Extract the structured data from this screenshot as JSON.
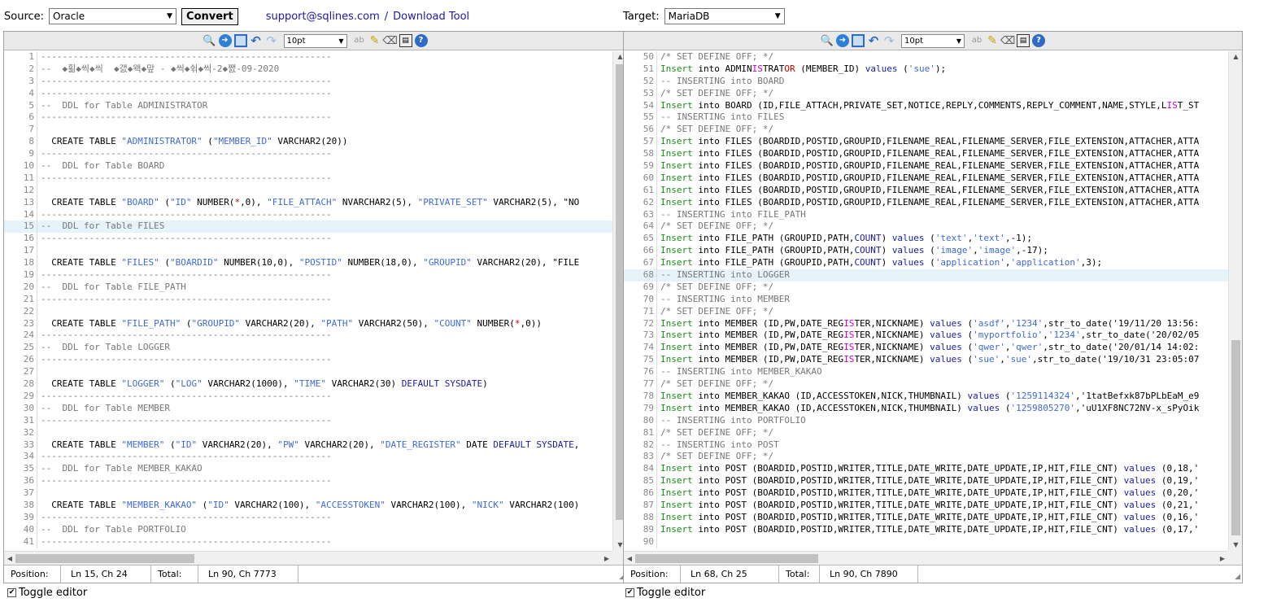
{
  "top": {
    "source_label": "Source:",
    "source_value": "Oracle",
    "convert_label": "Convert",
    "support_link": "support@sqlines.com",
    "separator": "/",
    "download_link": "Download Tool",
    "target_label": "Target:",
    "target_value": "MariaDB"
  },
  "toolbar": {
    "font_size": "10pt"
  },
  "left": {
    "status": {
      "pos_label": "Position:",
      "pos_value": "Ln 15, Ch 24",
      "total_label": "Total:",
      "total_value": "Ln 90, Ch 7773"
    },
    "lines": [
      {
        "n": "1",
        "t": "------------------------------------------------------",
        "c": "cm"
      },
      {
        "n": "2",
        "t": "--  ◆횖◆씩◆씩  ◆갨◆왝◆맢 - ◆씩◆쉮◆씩-2◆쨄-09-2020",
        "c": "cm"
      },
      {
        "n": "3",
        "t": "------------------------------------------------------",
        "c": "cm"
      },
      {
        "n": "4",
        "t": "------------------------------------------------------",
        "c": "cm"
      },
      {
        "n": "5",
        "t": "--  DDL for Table ADMINISTRATOR",
        "c": "cm"
      },
      {
        "n": "6",
        "t": "------------------------------------------------------",
        "c": "cm"
      },
      {
        "n": "7",
        "t": "",
        "c": "cm"
      },
      {
        "n": "8",
        "t": "  CREATE TABLE \"ADMINISTRATOR\" (\"MEMBER_ID\" VARCHAR2(20))",
        "c": "sql"
      },
      {
        "n": "9",
        "t": "------------------------------------------------------",
        "c": "cm"
      },
      {
        "n": "10",
        "t": "--  DDL for Table BOARD",
        "c": "cm"
      },
      {
        "n": "11",
        "t": "------------------------------------------------------",
        "c": "cm"
      },
      {
        "n": "12",
        "t": "",
        "c": "cm"
      },
      {
        "n": "13",
        "t": "  CREATE TABLE \"BOARD\" (\"ID\" NUMBER(*,0), \"FILE_ATTACH\" NVARCHAR2(5), \"PRIVATE_SET\" VARCHAR2(5), \"NO",
        "c": "sql"
      },
      {
        "n": "14",
        "t": "------------------------------------------------------",
        "c": "cm"
      },
      {
        "n": "15",
        "t": "--  DDL for Table FILES",
        "c": "cm",
        "active": true
      },
      {
        "n": "16",
        "t": "------------------------------------------------------",
        "c": "cm"
      },
      {
        "n": "17",
        "t": "",
        "c": "cm"
      },
      {
        "n": "18",
        "t": "  CREATE TABLE \"FILES\" (\"BOARDID\" NUMBER(10,0), \"POSTID\" NUMBER(18,0), \"GROUPID\" VARCHAR2(20), \"FILE",
        "c": "sql"
      },
      {
        "n": "19",
        "t": "------------------------------------------------------",
        "c": "cm"
      },
      {
        "n": "20",
        "t": "--  DDL for Table FILE_PATH",
        "c": "cm"
      },
      {
        "n": "21",
        "t": "------------------------------------------------------",
        "c": "cm"
      },
      {
        "n": "22",
        "t": "",
        "c": "cm"
      },
      {
        "n": "23",
        "t": "  CREATE TABLE \"FILE_PATH\" (\"GROUPID\" VARCHAR2(20), \"PATH\" VARCHAR2(50), \"COUNT\" NUMBER(*,0))",
        "c": "sql"
      },
      {
        "n": "24",
        "t": "------------------------------------------------------",
        "c": "cm"
      },
      {
        "n": "25",
        "t": "--  DDL for Table LOGGER",
        "c": "cm"
      },
      {
        "n": "26",
        "t": "------------------------------------------------------",
        "c": "cm"
      },
      {
        "n": "27",
        "t": "",
        "c": "cm"
      },
      {
        "n": "28",
        "t": "  CREATE TABLE \"LOGGER\" (\"LOG\" VARCHAR2(1000), \"TIME\" VARCHAR2(30) DEFAULT SYSDATE)",
        "c": "sql"
      },
      {
        "n": "29",
        "t": "------------------------------------------------------",
        "c": "cm"
      },
      {
        "n": "30",
        "t": "--  DDL for Table MEMBER",
        "c": "cm"
      },
      {
        "n": "31",
        "t": "------------------------------------------------------",
        "c": "cm"
      },
      {
        "n": "32",
        "t": "",
        "c": "cm"
      },
      {
        "n": "33",
        "t": "  CREATE TABLE \"MEMBER\" (\"ID\" VARCHAR2(20), \"PW\" VARCHAR2(20), \"DATE_REGISTER\" DATE DEFAULT SYSDATE,",
        "c": "sql"
      },
      {
        "n": "34",
        "t": "------------------------------------------------------",
        "c": "cm"
      },
      {
        "n": "35",
        "t": "--  DDL for Table MEMBER_KAKAO",
        "c": "cm"
      },
      {
        "n": "36",
        "t": "------------------------------------------------------",
        "c": "cm"
      },
      {
        "n": "37",
        "t": "",
        "c": "cm"
      },
      {
        "n": "38",
        "t": "  CREATE TABLE \"MEMBER_KAKAO\" (\"ID\" VARCHAR2(100), \"ACCESSTOKEN\" VARCHAR2(100), \"NICK\" VARCHAR2(100)",
        "c": "sql"
      },
      {
        "n": "39",
        "t": "------------------------------------------------------",
        "c": "cm"
      },
      {
        "n": "40",
        "t": "--  DDL for Table PORTFOLIO",
        "c": "cm"
      },
      {
        "n": "41",
        "t": "------------------------------------------------------",
        "c": "cm"
      }
    ]
  },
  "right": {
    "status": {
      "pos_label": "Position:",
      "pos_value": "Ln 68, Ch 25",
      "total_label": "Total:",
      "total_value": "Ln 90, Ch 7890"
    },
    "lines": [
      {
        "n": "50",
        "t": "/* SET DEFINE OFF; */",
        "c": "cm"
      },
      {
        "n": "51",
        "t": "Insert into ADMINISTRATOR (MEMBER_ID) values ('sue');",
        "c": "ins"
      },
      {
        "n": "52",
        "t": "-- INSERTING into BOARD",
        "c": "cm"
      },
      {
        "n": "53",
        "t": "/* SET DEFINE OFF; */",
        "c": "cm"
      },
      {
        "n": "54",
        "t": "Insert into BOARD (ID,FILE_ATTACH,PRIVATE_SET,NOTICE,REPLY,COMMENTS,REPLY_COMMENT,NAME,STYLE,LIST_ST",
        "c": "ins"
      },
      {
        "n": "55",
        "t": "-- INSERTING into FILES",
        "c": "cm"
      },
      {
        "n": "56",
        "t": "/* SET DEFINE OFF; */",
        "c": "cm"
      },
      {
        "n": "57",
        "t": "Insert into FILES (BOARDID,POSTID,GROUPID,FILENAME_REAL,FILENAME_SERVER,FILE_EXTENSION,ATTACHER,ATTA",
        "c": "ins"
      },
      {
        "n": "58",
        "t": "Insert into FILES (BOARDID,POSTID,GROUPID,FILENAME_REAL,FILENAME_SERVER,FILE_EXTENSION,ATTACHER,ATTA",
        "c": "ins"
      },
      {
        "n": "59",
        "t": "Insert into FILES (BOARDID,POSTID,GROUPID,FILENAME_REAL,FILENAME_SERVER,FILE_EXTENSION,ATTACHER,ATTA",
        "c": "ins"
      },
      {
        "n": "60",
        "t": "Insert into FILES (BOARDID,POSTID,GROUPID,FILENAME_REAL,FILENAME_SERVER,FILE_EXTENSION,ATTACHER,ATTA",
        "c": "ins"
      },
      {
        "n": "61",
        "t": "Insert into FILES (BOARDID,POSTID,GROUPID,FILENAME_REAL,FILENAME_SERVER,FILE_EXTENSION,ATTACHER,ATTA",
        "c": "ins"
      },
      {
        "n": "62",
        "t": "Insert into FILES (BOARDID,POSTID,GROUPID,FILENAME_REAL,FILENAME_SERVER,FILE_EXTENSION,ATTACHER,ATTA",
        "c": "ins"
      },
      {
        "n": "63",
        "t": "-- INSERTING into FILE_PATH",
        "c": "cm"
      },
      {
        "n": "64",
        "t": "/* SET DEFINE OFF; */",
        "c": "cm"
      },
      {
        "n": "65",
        "t": "Insert into FILE_PATH (GROUPID,PATH,COUNT) values ('text','text',-1);",
        "c": "ins"
      },
      {
        "n": "66",
        "t": "Insert into FILE_PATH (GROUPID,PATH,COUNT) values ('image','image',-17);",
        "c": "ins"
      },
      {
        "n": "67",
        "t": "Insert into FILE_PATH (GROUPID,PATH,COUNT) values ('application','application',3);",
        "c": "ins"
      },
      {
        "n": "68",
        "t": "-- INSERTING into LOGGER",
        "c": "cm",
        "active": true
      },
      {
        "n": "69",
        "t": "/* SET DEFINE OFF; */",
        "c": "cm"
      },
      {
        "n": "70",
        "t": "-- INSERTING into MEMBER",
        "c": "cm"
      },
      {
        "n": "71",
        "t": "/* SET DEFINE OFF; */",
        "c": "cm"
      },
      {
        "n": "72",
        "t": "Insert into MEMBER (ID,PW,DATE_REGISTER,NICKNAME) values ('asdf','1234',str_to_date('19/11/20 13:56:",
        "c": "ins"
      },
      {
        "n": "73",
        "t": "Insert into MEMBER (ID,PW,DATE_REGISTER,NICKNAME) values ('myportfolio','1234',str_to_date('20/02/05",
        "c": "ins"
      },
      {
        "n": "74",
        "t": "Insert into MEMBER (ID,PW,DATE_REGISTER,NICKNAME) values ('qwer','qwer',str_to_date('20/01/14 14:02:",
        "c": "ins"
      },
      {
        "n": "75",
        "t": "Insert into MEMBER (ID,PW,DATE_REGISTER,NICKNAME) values ('sue','sue',str_to_date('19/10/31 23:05:07",
        "c": "ins"
      },
      {
        "n": "76",
        "t": "-- INSERTING into MEMBER_KAKAO",
        "c": "cm"
      },
      {
        "n": "77",
        "t": "/* SET DEFINE OFF; */",
        "c": "cm"
      },
      {
        "n": "78",
        "t": "Insert into MEMBER_KAKAO (ID,ACCESSTOKEN,NICK,THUMBNAIL) values ('1259114324','1tatBefxk87bPLbEaM_e9",
        "c": "ins"
      },
      {
        "n": "79",
        "t": "Insert into MEMBER_KAKAO (ID,ACCESSTOKEN,NICK,THUMBNAIL) values ('1259805270','uU1XF8NC72NV-x_sPyOik",
        "c": "ins"
      },
      {
        "n": "80",
        "t": "-- INSERTING into PORTFOLIO",
        "c": "cm"
      },
      {
        "n": "81",
        "t": "/* SET DEFINE OFF; */",
        "c": "cm"
      },
      {
        "n": "82",
        "t": "-- INSERTING into POST",
        "c": "cm"
      },
      {
        "n": "83",
        "t": "/* SET DEFINE OFF; */",
        "c": "cm"
      },
      {
        "n": "84",
        "t": "Insert into POST (BOARDID,POSTID,WRITER,TITLE,DATE_WRITE,DATE_UPDATE,IP,HIT,FILE_CNT) values (0,18,'",
        "c": "ins"
      },
      {
        "n": "85",
        "t": "Insert into POST (BOARDID,POSTID,WRITER,TITLE,DATE_WRITE,DATE_UPDATE,IP,HIT,FILE_CNT) values (0,19,'",
        "c": "ins"
      },
      {
        "n": "86",
        "t": "Insert into POST (BOARDID,POSTID,WRITER,TITLE,DATE_WRITE,DATE_UPDATE,IP,HIT,FILE_CNT) values (0,20,'",
        "c": "ins"
      },
      {
        "n": "87",
        "t": "Insert into POST (BOARDID,POSTID,WRITER,TITLE,DATE_WRITE,DATE_UPDATE,IP,HIT,FILE_CNT) values (0,21,'",
        "c": "ins"
      },
      {
        "n": "88",
        "t": "Insert into POST (BOARDID,POSTID,WRITER,TITLE,DATE_WRITE,DATE_UPDATE,IP,HIT,FILE_CNT) values (0,16,'",
        "c": "ins"
      },
      {
        "n": "89",
        "t": "Insert into POST (BOARDID,POSTID,WRITER,TITLE,DATE_WRITE,DATE_UPDATE,IP,HIT,FILE_CNT) values (0,17,'",
        "c": "ins"
      },
      {
        "n": "90",
        "t": "",
        "c": "cm"
      }
    ]
  },
  "toggle_label": "Toggle editor",
  "colors": {
    "comment": "#777777",
    "string": "#3d6ad6",
    "insert": "#1a8a1a",
    "values": "#1a1aa6",
    "active_line": "#e6f3fa"
  }
}
